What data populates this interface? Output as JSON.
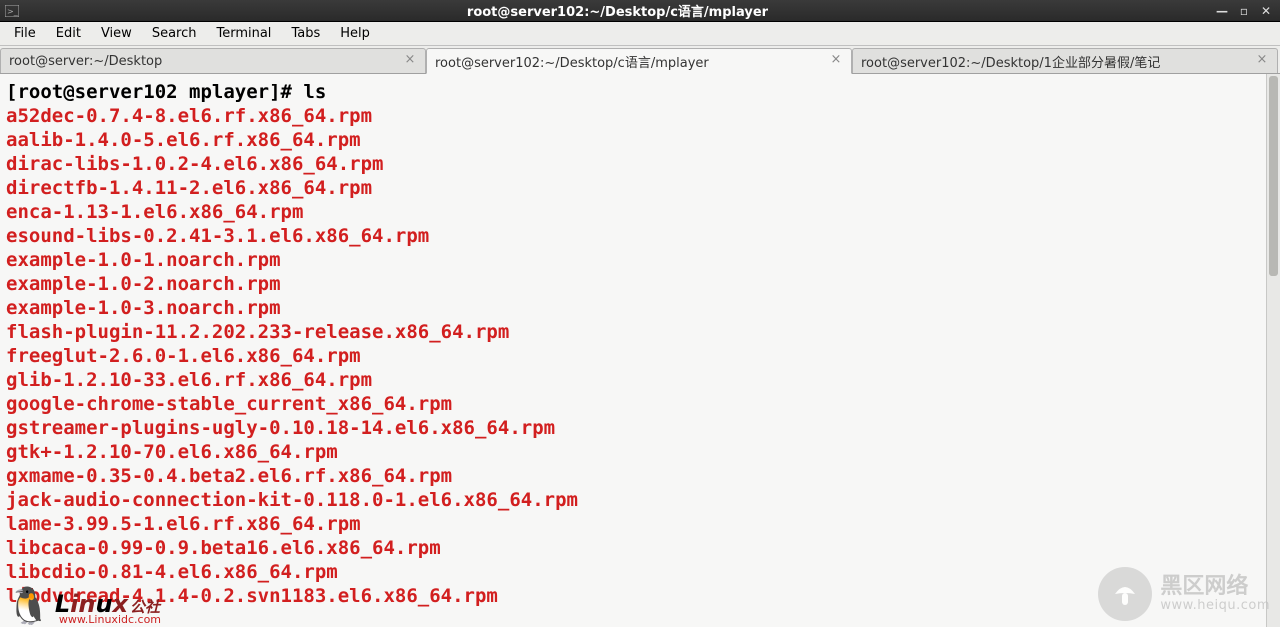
{
  "window": {
    "title": "root@server102:~/Desktop/c语言/mplayer"
  },
  "menu": {
    "file": "File",
    "edit": "Edit",
    "view": "View",
    "search": "Search",
    "terminal": "Terminal",
    "tabs": "Tabs",
    "help": "Help"
  },
  "tabs": [
    {
      "label": "root@server:~/Desktop",
      "active": false
    },
    {
      "label": "root@server102:~/Desktop/c语言/mplayer",
      "active": true
    },
    {
      "label": "root@server102:~/Desktop/1企业部分暑假/笔记",
      "active": false
    }
  ],
  "terminal": {
    "prompt": "[root@server102 mplayer]# ",
    "command": "ls",
    "files": [
      "a52dec-0.7.4-8.el6.rf.x86_64.rpm",
      "aalib-1.4.0-5.el6.rf.x86_64.rpm",
      "dirac-libs-1.0.2-4.el6.x86_64.rpm",
      "directfb-1.4.11-2.el6.x86_64.rpm",
      "enca-1.13-1.el6.x86_64.rpm",
      "esound-libs-0.2.41-3.1.el6.x86_64.rpm",
      "example-1.0-1.noarch.rpm",
      "example-1.0-2.noarch.rpm",
      "example-1.0-3.noarch.rpm",
      "flash-plugin-11.2.202.233-release.x86_64.rpm",
      "freeglut-2.6.0-1.el6.x86_64.rpm",
      "glib-1.2.10-33.el6.rf.x86_64.rpm",
      "google-chrome-stable_current_x86_64.rpm",
      "gstreamer-plugins-ugly-0.10.18-14.el6.x86_64.rpm",
      "gtk+-1.2.10-70.el6.x86_64.rpm",
      "gxmame-0.35-0.4.beta2.el6.rf.x86_64.rpm",
      "jack-audio-connection-kit-0.118.0-1.el6.x86_64.rpm",
      "lame-3.99.5-1.el6.rf.x86_64.rpm",
      "libcaca-0.99-0.9.beta16.el6.x86_64.rpm",
      "libcdio-0.81-4.el6.x86_64.rpm",
      "libdvdread-4.1.4-0.2.svn1183.el6.x86_64.rpm"
    ]
  },
  "watermarks": {
    "right_cn": "黑区网络",
    "right_url": "www.heiqu.com",
    "left_brand": "Linux",
    "left_suffix": "公社",
    "left_url": "www.Linuxidc.com"
  }
}
